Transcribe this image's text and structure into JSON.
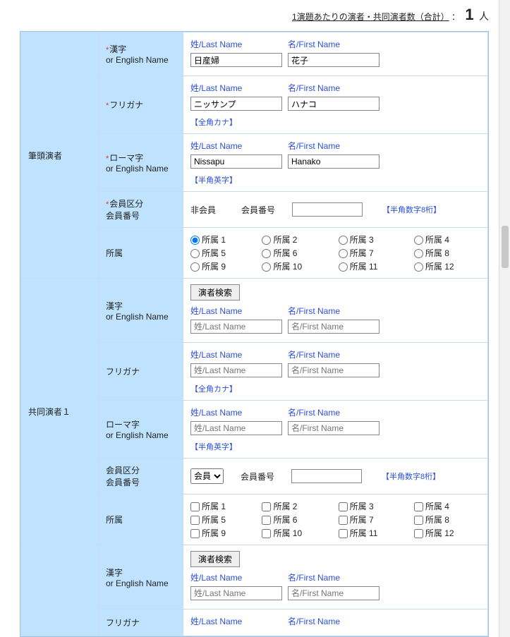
{
  "header": {
    "prefix": "1演題あたりの演者・共同演者数（合計）",
    "colon": "：",
    "count": "1",
    "unit": "人"
  },
  "labels": {
    "last_name": "姓/Last Name",
    "first_name": "名/First Name",
    "last_name_ph": "姓/Last Name",
    "first_name_ph": "名/First Name",
    "full_kana_hint": "【全角カナ】",
    "half_alpha_hint": "【半角英字】",
    "half_num8_hint": "【半角数字8桁】",
    "kanji_or_en": "漢字\nor English Name",
    "furigana": "フリガナ",
    "romaji_or_en": "ローマ字\nor English Name",
    "member_cat_no": "会員区分\n会員番号",
    "affiliation": "所属",
    "main_presenter": "筆頭演者",
    "co_presenter_1": "共同演者１",
    "member_no": "会員番号",
    "non_member": "非会員",
    "member": "会員",
    "search_button": "演者検索"
  },
  "main": {
    "kanji": {
      "last": "日産婦",
      "first": "花子"
    },
    "kana": {
      "last": "ニッサンプ",
      "first": "ハナコ"
    },
    "roma": {
      "last": "Nissapu",
      "first": "Hanako"
    },
    "member_status": "非会員",
    "member_no": ""
  },
  "affiliations": [
    "所属 1",
    "所属 2",
    "所属 3",
    "所属 4",
    "所属 5",
    "所属 6",
    "所属 7",
    "所属 8",
    "所属 9",
    "所属 10",
    "所属 11",
    "所属 12"
  ],
  "main_affiliation_selected": 0,
  "chart_data": {
    "type": "table",
    "note": "form screenshot, no chart"
  }
}
